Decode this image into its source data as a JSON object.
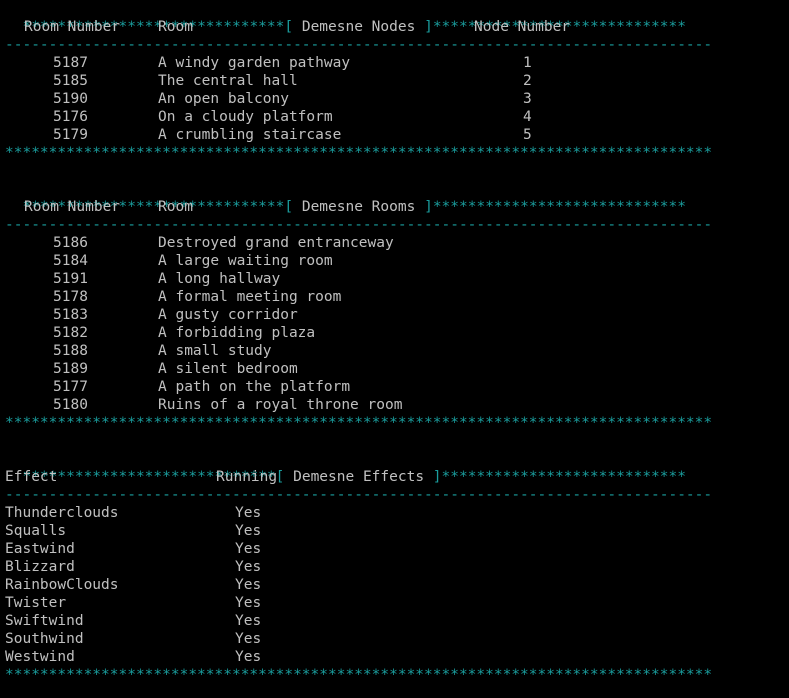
{
  "separators": {
    "star_line": "*********************************************************************************",
    "dash_line": "---------------------------------------------------------------------------------",
    "nodes_left": "******************************",
    "nodes_right": "*****************************",
    "rooms_left": "******************************",
    "rooms_right": "*****************************",
    "effects_left": "*****************************",
    "effects_right": "****************************",
    "open_bracket": "[ ",
    "close_bracket": " ]"
  },
  "nodes": {
    "title": "Demesne Nodes",
    "header_room_number": "Room Number",
    "header_room": "Room",
    "header_node_number": "Node Number",
    "rows": [
      {
        "num": "5187",
        "room": "A windy garden pathway",
        "node": "1"
      },
      {
        "num": "5185",
        "room": "The central hall",
        "node": "2"
      },
      {
        "num": "5190",
        "room": "An open balcony",
        "node": "3"
      },
      {
        "num": "5176",
        "room": "On a cloudy platform",
        "node": "4"
      },
      {
        "num": "5179",
        "room": "A crumbling staircase",
        "node": "5"
      }
    ]
  },
  "rooms": {
    "title": "Demesne Rooms",
    "header_room_number": "Room Number",
    "header_room": "Room",
    "rows": [
      {
        "num": "5186",
        "room": "Destroyed grand entranceway"
      },
      {
        "num": "5184",
        "room": "A large waiting room"
      },
      {
        "num": "5191",
        "room": "A long hallway"
      },
      {
        "num": "5178",
        "room": "A formal meeting room"
      },
      {
        "num": "5183",
        "room": "A gusty corridor"
      },
      {
        "num": "5182",
        "room": "A forbidding plaza"
      },
      {
        "num": "5188",
        "room": "A small study"
      },
      {
        "num": "5189",
        "room": "A silent bedroom"
      },
      {
        "num": "5177",
        "room": "A path on the platform"
      },
      {
        "num": "5180",
        "room": "Ruins of a royal throne room"
      }
    ]
  },
  "effects": {
    "title": "Demesne Effects",
    "header_effect": "Effect",
    "header_running": "Running",
    "rows": [
      {
        "effect": "Thunderclouds",
        "running": "Yes"
      },
      {
        "effect": "Squalls",
        "running": "Yes"
      },
      {
        "effect": "Eastwind",
        "running": "Yes"
      },
      {
        "effect": "Blizzard",
        "running": "Yes"
      },
      {
        "effect": "RainbowClouds",
        "running": "Yes"
      },
      {
        "effect": "Twister",
        "running": "Yes"
      },
      {
        "effect": "Swiftwind",
        "running": "Yes"
      },
      {
        "effect": "Southwind",
        "running": "Yes"
      },
      {
        "effect": "Westwind",
        "running": "Yes"
      }
    ]
  },
  "colors": {
    "background": "#000000",
    "text": "#c0c0c0",
    "separator": "#1a9d9d"
  }
}
